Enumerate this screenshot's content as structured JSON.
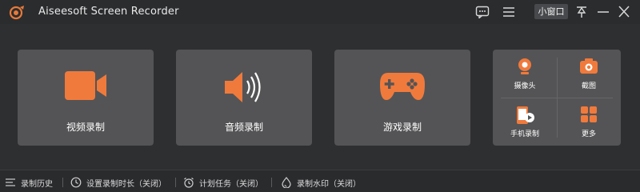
{
  "app": {
    "title": "Aiseesoft Screen Recorder"
  },
  "titlebar": {
    "mini_window_label": "小窗口",
    "icons": [
      "feedback-icon",
      "menu-icon",
      "pin-icon",
      "minimize-icon",
      "close-icon"
    ]
  },
  "tiles": [
    {
      "label": "视频录制",
      "icon": "video-camera-icon"
    },
    {
      "label": "音频录制",
      "icon": "speaker-icon"
    },
    {
      "label": "游戏录制",
      "icon": "gamepad-icon"
    }
  ],
  "multi": [
    {
      "label": "摄像头",
      "icon": "webcam-icon"
    },
    {
      "label": "截图",
      "icon": "camera-snapshot-icon"
    },
    {
      "label": "手机录制",
      "icon": "phone-record-icon"
    },
    {
      "label": "更多",
      "icon": "grid-more-icon"
    }
  ],
  "statusbar": {
    "history": "录制历史",
    "duration": "设置录制时长（关闭）",
    "schedule": "计划任务（关闭）",
    "watermark": "录制水印（关闭）"
  },
  "colors": {
    "accent": "#f07a3c",
    "tile_bg": "#545456",
    "window_bg": "#2e2f31"
  }
}
